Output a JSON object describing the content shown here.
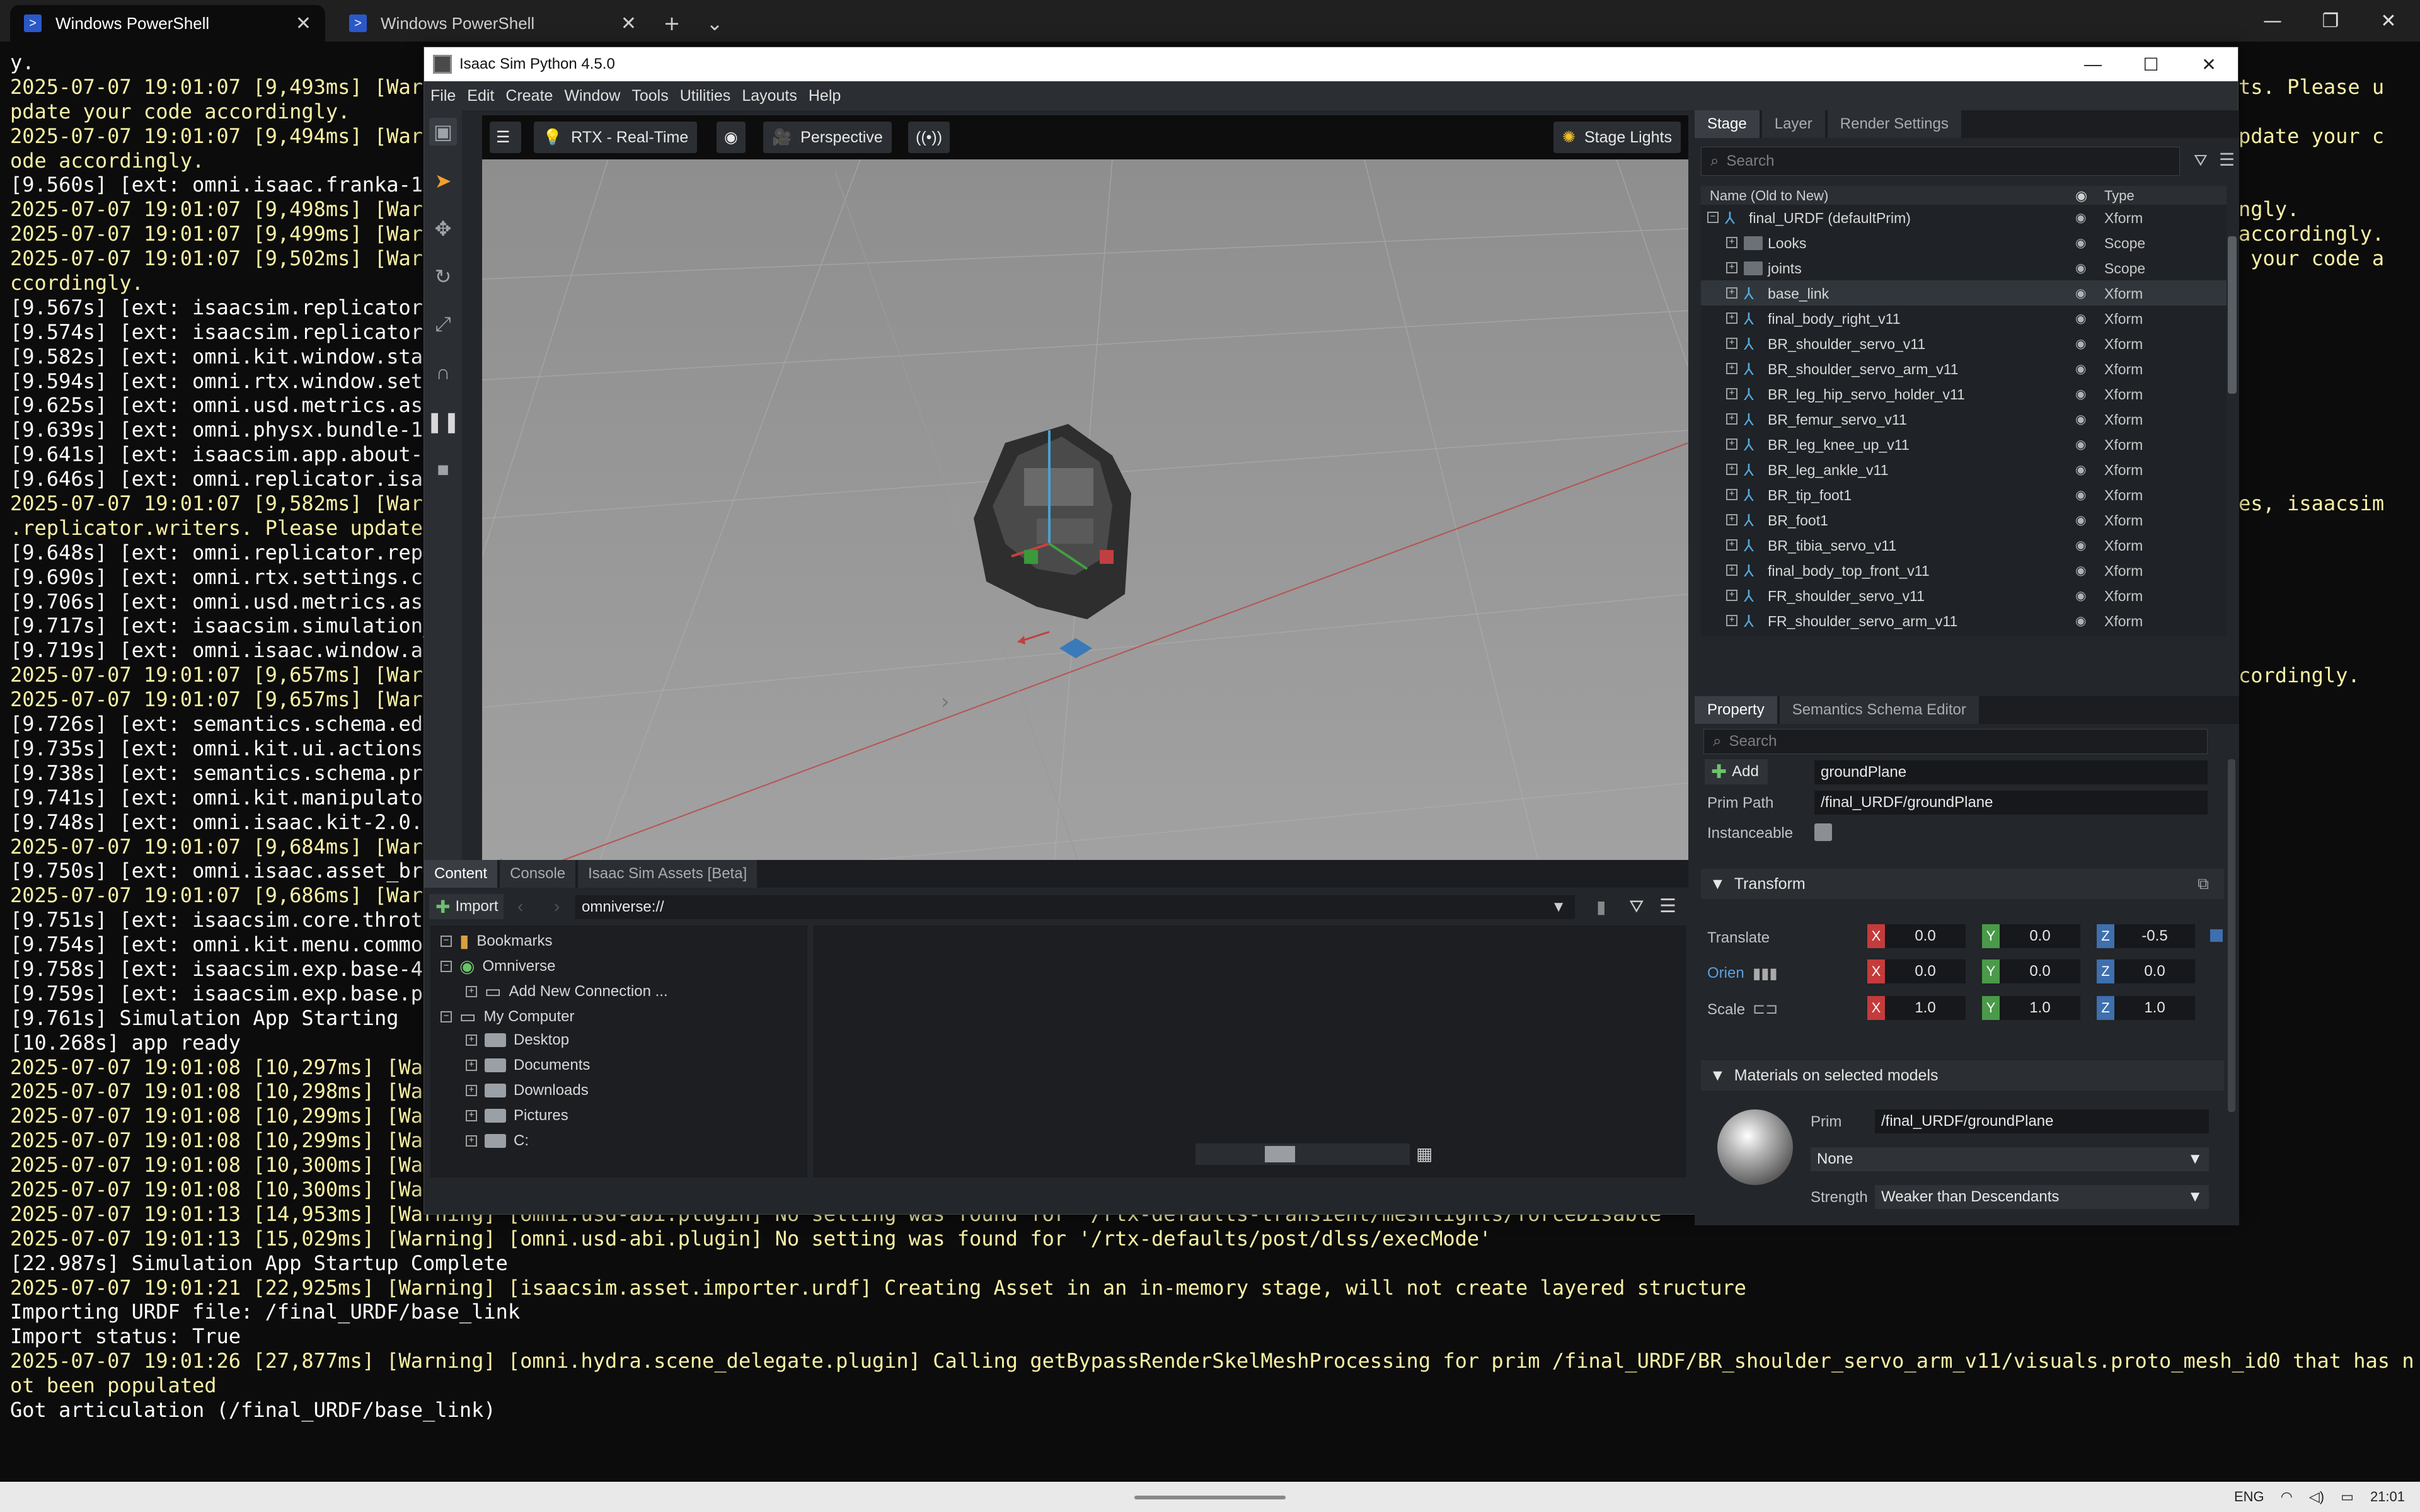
{
  "terminal": {
    "tabs": [
      {
        "title": "Windows PowerShell",
        "active": true
      },
      {
        "title": "Windows PowerShell",
        "active": false
      }
    ],
    "lines": [
      {
        "t": "y.",
        "c": "n"
      },
      {
        "t": "2025-07-07 19:01:07 [9,493ms] [Warn",
        "c": "w"
      },
      {
        "t": "pdate your code accordingly.",
        "c": "w"
      },
      {
        "t": "2025-07-07 19:01:07 [9,494ms] [Warn",
        "c": "w"
      },
      {
        "t": "ode accordingly.",
        "c": "w"
      },
      {
        "t": "[9.560s] [ext: omni.isaac.franka-1",
        "c": "n"
      },
      {
        "t": "2025-07-07 19:01:07 [9,498ms] [Warn",
        "c": "w"
      },
      {
        "t": "2025-07-07 19:01:07 [9,499ms] [Warn",
        "c": "w"
      },
      {
        "t": "2025-07-07 19:01:07 [9,502ms] [Warn",
        "c": "w"
      },
      {
        "t": "ccordingly.",
        "c": "w"
      },
      {
        "t": "[9.567s] [ext: isaacsim.replicator.",
        "c": "n"
      },
      {
        "t": "[9.574s] [ext: isaacsim.replicator.",
        "c": "n"
      },
      {
        "t": "[9.582s] [ext: omni.kit.window.stat",
        "c": "n"
      },
      {
        "t": "[9.594s] [ext: omni.rtx.window.sett",
        "c": "n"
      },
      {
        "t": "[9.625s] [ext: omni.usd.metrics.ass",
        "c": "n"
      },
      {
        "t": "[9.639s] [ext: omni.physx.bundle-10",
        "c": "n"
      },
      {
        "t": "[9.641s] [ext: isaacsim.app.about-2",
        "c": "n"
      },
      {
        "t": "[9.646s] [ext: omni.replicator.isaa",
        "c": "n"
      },
      {
        "t": "2025-07-07 19:01:07 [9,582ms] [Warn",
        "c": "w"
      },
      {
        "t": ".replicator.writers. Please update",
        "c": "w"
      },
      {
        "t": "[9.648s] [ext: omni.replicator.repl",
        "c": "n"
      },
      {
        "t": "[9.690s] [ext: omni.rtx.settings.co",
        "c": "n"
      },
      {
        "t": "[9.706s] [ext: omni.usd.metrics.ass",
        "c": "n"
      },
      {
        "t": "[9.717s] [ext: isaacsim.simulation_",
        "c": "n"
      },
      {
        "t": "[9.719s] [ext: omni.isaac.window.ab",
        "c": "n"
      },
      {
        "t": "2025-07-07 19:01:07 [9,657ms] [Warn",
        "c": "w"
      },
      {
        "t": "2025-07-07 19:01:07 [9,657ms] [Warn",
        "c": "w"
      },
      {
        "t": "[9.726s] [ext: semantics.schema.edi",
        "c": "n"
      },
      {
        "t": "[9.735s] [ext: omni.kit.ui.actions-",
        "c": "n"
      },
      {
        "t": "[9.738s] [ext: semantics.schema.pro",
        "c": "n"
      },
      {
        "t": "[9.741s] [ext: omni.kit.manipulator",
        "c": "n"
      },
      {
        "t": "[9.748s] [ext: omni.isaac.kit-2.0.3",
        "c": "n"
      },
      {
        "t": "2025-07-07 19:01:07 [9,684ms] [Warn",
        "c": "w"
      },
      {
        "t": "[9.750s] [ext: omni.isaac.asset_bro",
        "c": "n"
      },
      {
        "t": "2025-07-07 19:01:07 [9,686ms] [Warn",
        "c": "w"
      },
      {
        "t": "[9.751s] [ext: isaacsim.core.thrott",
        "c": "n"
      },
      {
        "t": "[9.754s] [ext: omni.kit.menu.common",
        "c": "n"
      },
      {
        "t": "[9.758s] [ext: isaacsim.exp.base-4.",
        "c": "n"
      },
      {
        "t": "[9.759s] [ext: isaacsim.exp.base.py",
        "c": "n"
      },
      {
        "t": "[9.761s] Simulation App Starting",
        "c": "n"
      },
      {
        "t": "[10.268s] app ready",
        "c": "n"
      },
      {
        "t": "2025-07-07 19:01:08 [10,297ms] [War",
        "c": "w"
      },
      {
        "t": "2025-07-07 19:01:08 [10,298ms] [War",
        "c": "w"
      },
      {
        "t": "2025-07-07 19:01:08 [10,299ms] [War",
        "c": "w"
      },
      {
        "t": "2025-07-07 19:01:08 [10,299ms] [War",
        "c": "w"
      },
      {
        "t": "2025-07-07 19:01:08 [10,300ms] [War",
        "c": "w"
      },
      {
        "t": "2025-07-07 19:01:08 [10,300ms] [War",
        "c": "w"
      },
      {
        "t": "2025-07-07 19:01:13 [14,953ms] [Warning] [omni.usd-abi.plugin] No setting was found for '/rtx-defaults-transient/meshlights/forceDisable'",
        "c": "w"
      },
      {
        "t": "2025-07-07 19:01:13 [15,029ms] [Warning] [omni.usd-abi.plugin] No setting was found for '/rtx-defaults/post/dlss/execMode'",
        "c": "w"
      },
      {
        "t": "[22.987s] Simulation App Startup Complete",
        "c": "n"
      },
      {
        "t": "2025-07-07 19:01:21 [22,925ms] [Warning] [isaacsim.asset.importer.urdf] Creating Asset in an in-memory stage, will not create layered structure",
        "c": "w"
      },
      {
        "t": "Importing URDF file: /final_URDF/base_link",
        "c": "n"
      },
      {
        "t": "Import status: True",
        "c": "n"
      },
      {
        "t": "2025-07-07 19:01:26 [27,877ms] [Warning] [omni.hydra.scene_delegate.plugin] Calling getBypassRenderSkelMeshProcessing for prim /final_URDF/BR_shoulder_servo_arm_v11/visuals.proto_mesh_id0 that has n",
        "c": "w"
      },
      {
        "t": "ot been populated",
        "c": "w"
      },
      {
        "t": "Got articulation (/final_URDF/base_link)",
        "c": "n"
      }
    ],
    "right_fragments": [
      {
        "t": "ts. Please u",
        "line": 1
      },
      {
        "t": "pdate your c",
        "line": 3
      },
      {
        "t": "ngly.",
        "line": 6
      },
      {
        "t": "accordingly.",
        "line": 7
      },
      {
        "t": " your code a",
        "line": 8
      },
      {
        "t": "es, isaacsim",
        "line": 18
      },
      {
        "t": "cordingly.",
        "line": 25
      }
    ]
  },
  "taskbar": {
    "lang": "ENG",
    "time": "21:01"
  },
  "isaac": {
    "title": "Isaac Sim Python 4.5.0",
    "menu": [
      "File",
      "Edit",
      "Create",
      "Window",
      "Tools",
      "Utilities",
      "Layouts",
      "Help"
    ],
    "viewport": {
      "renderer": "RTX - Real-Time",
      "camera": "Perspective",
      "lights": "Stage Lights"
    },
    "stage": {
      "tabs": [
        "Stage",
        "Layer",
        "Render Settings"
      ],
      "search_placeholder": "Search",
      "col_name": "Name (Old to New)",
      "col_type": "Type",
      "rows": [
        {
          "name": "final_URDF (defaultPrim)",
          "type": "Xform",
          "depth": 0,
          "kind": "xform",
          "exp": "−"
        },
        {
          "name": "Looks",
          "type": "Scope",
          "depth": 1,
          "kind": "folder",
          "exp": "+"
        },
        {
          "name": "joints",
          "type": "Scope",
          "depth": 1,
          "kind": "folder",
          "exp": "+"
        },
        {
          "name": "base_link",
          "type": "Xform",
          "depth": 1,
          "kind": "xform",
          "exp": "+",
          "selected": true
        },
        {
          "name": "final_body_right_v11",
          "type": "Xform",
          "depth": 1,
          "kind": "xform",
          "exp": "+"
        },
        {
          "name": "BR_shoulder_servo_v11",
          "type": "Xform",
          "depth": 1,
          "kind": "xform",
          "exp": "+"
        },
        {
          "name": "BR_shoulder_servo_arm_v11",
          "type": "Xform",
          "depth": 1,
          "kind": "xform",
          "exp": "+"
        },
        {
          "name": "BR_leg_hip_servo_holder_v11",
          "type": "Xform",
          "depth": 1,
          "kind": "xform",
          "exp": "+"
        },
        {
          "name": "BR_femur_servo_v11",
          "type": "Xform",
          "depth": 1,
          "kind": "xform",
          "exp": "+"
        },
        {
          "name": "BR_leg_knee_up_v11",
          "type": "Xform",
          "depth": 1,
          "kind": "xform",
          "exp": "+"
        },
        {
          "name": "BR_leg_ankle_v11",
          "type": "Xform",
          "depth": 1,
          "kind": "xform",
          "exp": "+"
        },
        {
          "name": "BR_tip_foot1",
          "type": "Xform",
          "depth": 1,
          "kind": "xform",
          "exp": "+"
        },
        {
          "name": "BR_foot1",
          "type": "Xform",
          "depth": 1,
          "kind": "xform",
          "exp": "+"
        },
        {
          "name": "BR_tibia_servo_v11",
          "type": "Xform",
          "depth": 1,
          "kind": "xform",
          "exp": "+"
        },
        {
          "name": "final_body_top_front_v11",
          "type": "Xform",
          "depth": 1,
          "kind": "xform",
          "exp": "+"
        },
        {
          "name": "FR_shoulder_servo_v11",
          "type": "Xform",
          "depth": 1,
          "kind": "xform",
          "exp": "+"
        },
        {
          "name": "FR_shoulder_servo_arm_v11",
          "type": "Xform",
          "depth": 1,
          "kind": "xform",
          "exp": "+"
        }
      ]
    },
    "property": {
      "tabs": [
        "Property",
        "Semantics Schema Editor"
      ],
      "search_placeholder": "Search",
      "add_label": "Add",
      "prim_name": "groundPlane",
      "prim_path_label": "Prim Path",
      "prim_path": "/final_URDF/groundPlane",
      "instanceable_label": "Instanceable",
      "transform_label": "Transform",
      "translate_label": "Translate",
      "orient_label": "Orien",
      "scale_label": "Scale",
      "translate": {
        "x": "0.0",
        "y": "0.0",
        "z": "-0.5"
      },
      "orient": {
        "x": "0.0",
        "y": "0.0",
        "z": "0.0"
      },
      "scale": {
        "x": "1.0",
        "y": "1.0",
        "z": "1.0"
      },
      "axis_x": "X",
      "axis_y": "Y",
      "axis_z": "Z",
      "materials_label": "Materials on selected models",
      "mat_prim_label": "Prim",
      "mat_prim": "/final_URDF/groundPlane",
      "mat_value": "None",
      "strength_label": "Strength",
      "strength_value": "Weaker than Descendants"
    },
    "content": {
      "tabs": [
        "Content",
        "Console",
        "Isaac Sim Assets [Beta]"
      ],
      "import_label": "Import",
      "path": "omniverse://",
      "tree": [
        {
          "label": "Bookmarks",
          "depth": 0,
          "exp": "−",
          "icon": "bookmark"
        },
        {
          "label": "Omniverse",
          "depth": 0,
          "exp": "−",
          "icon": "omni"
        },
        {
          "label": "Add New Connection ...",
          "depth": 1,
          "exp": "+",
          "icon": "server"
        },
        {
          "label": "My Computer",
          "depth": 0,
          "exp": "−",
          "icon": "computer"
        },
        {
          "label": "Desktop",
          "depth": 1,
          "exp": "+",
          "icon": "drive"
        },
        {
          "label": "Documents",
          "depth": 1,
          "exp": "+",
          "icon": "drive"
        },
        {
          "label": "Downloads",
          "depth": 1,
          "exp": "+",
          "icon": "drive"
        },
        {
          "label": "Pictures",
          "depth": 1,
          "exp": "+",
          "icon": "drive"
        },
        {
          "label": "C:",
          "depth": 1,
          "exp": "+",
          "icon": "drive"
        }
      ]
    }
  }
}
